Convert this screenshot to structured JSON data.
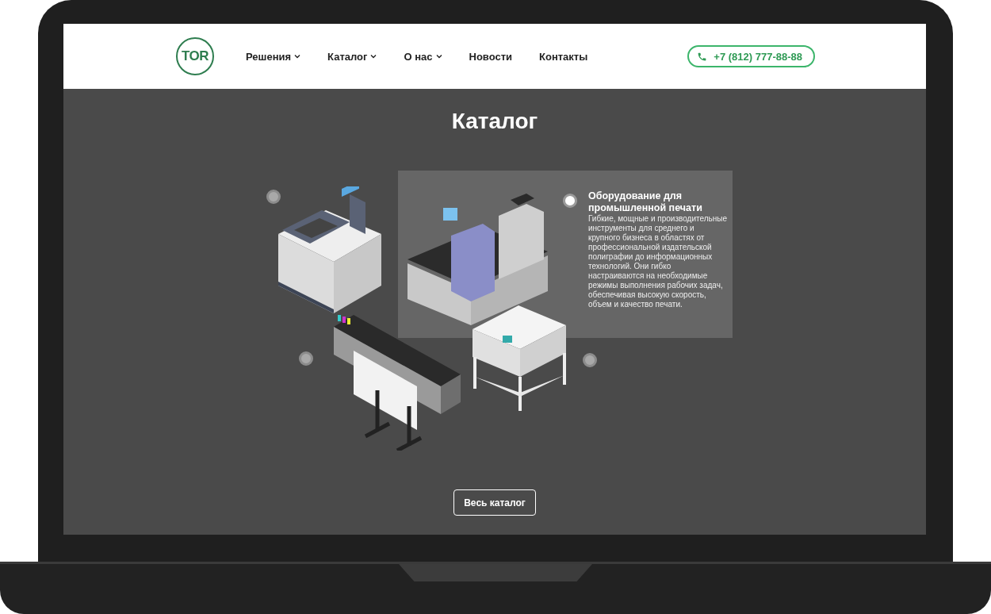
{
  "header": {
    "logo": "TOR",
    "nav": [
      {
        "label": "Решения",
        "dropdown": true
      },
      {
        "label": "Каталог",
        "dropdown": true
      },
      {
        "label": "О нас",
        "dropdown": true
      },
      {
        "label": "Новости",
        "dropdown": false
      },
      {
        "label": "Контакты",
        "dropdown": false
      }
    ],
    "phone": "+7 (812) 777-88-88"
  },
  "catalog": {
    "title": "Каталог",
    "products": [
      {
        "kind": "copier",
        "selected": false
      },
      {
        "kind": "production-printer",
        "selected": true,
        "title": "Оборудование для промышленной печати",
        "description": "Гибкие, мощные и производительные инструменты для среднего и крупного бизнеса в областях от профессиональной издательской полиграфии до информационных технологий. Они гибко настраиваются на необходимые режимы выполнения рабочих задач, обеспечивая высокую скорость, объем и качество печати."
      },
      {
        "kind": "plotter",
        "selected": false
      },
      {
        "kind": "cutter",
        "selected": false
      }
    ],
    "button": "Весь каталог"
  }
}
